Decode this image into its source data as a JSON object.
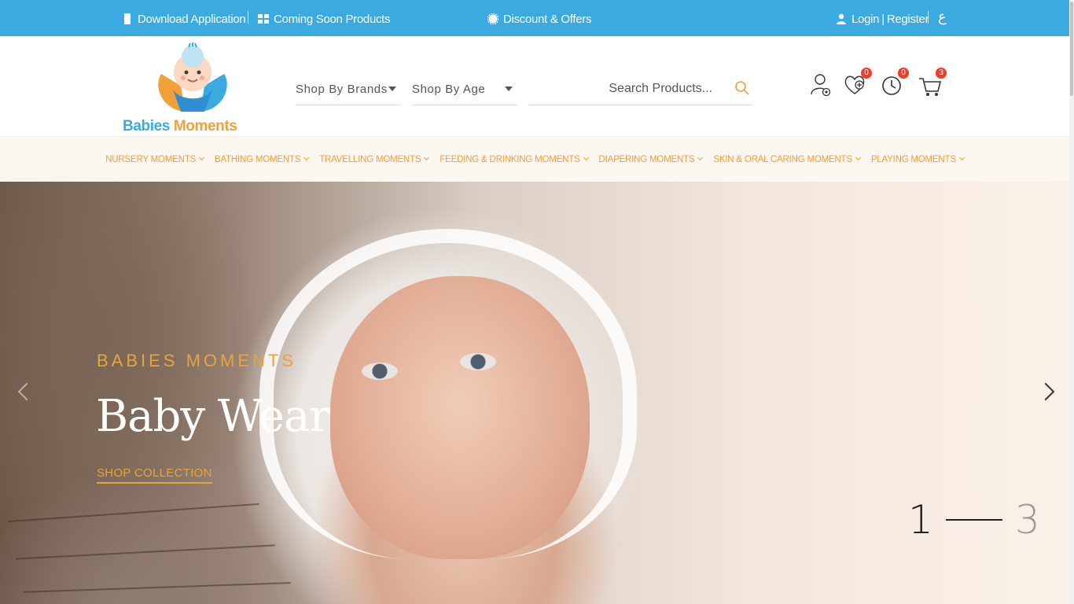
{
  "topbar": {
    "download": "Download Application",
    "coming_soon": "Coming Soon Products",
    "discount": "Discount & Offers",
    "login": "Login",
    "register": "Register",
    "separator": "|",
    "language": "ع"
  },
  "logo": {
    "part1": "Babies",
    "part2": "Moments"
  },
  "header": {
    "shop_by_brands": "Shop By Brands",
    "shop_by_age": "Shop By Age",
    "search_placeholder": "Search Products...",
    "wishlist_count": "0",
    "recent_count": "0",
    "cart_count": "3"
  },
  "categories": [
    "NURSERY MOMENTS",
    "BATHING MOMENTS",
    "TRAVELLING MOMENTS",
    "FEEDING & DRINKING MOMENTS",
    "DIAPERING MOMENTS",
    "SKIN & ORAL CARING MOMENTS",
    "PLAYING MOMENTS"
  ],
  "hero": {
    "subtitle": "BABIES MOMENTS",
    "title": "Baby Wear",
    "cta": "SHOP COLLECTION",
    "current_slide": "1",
    "total_slides": "3"
  },
  "colors": {
    "topbar": "#3aaae1",
    "accent": "#f29c38",
    "badge": "#ee3b2b"
  }
}
